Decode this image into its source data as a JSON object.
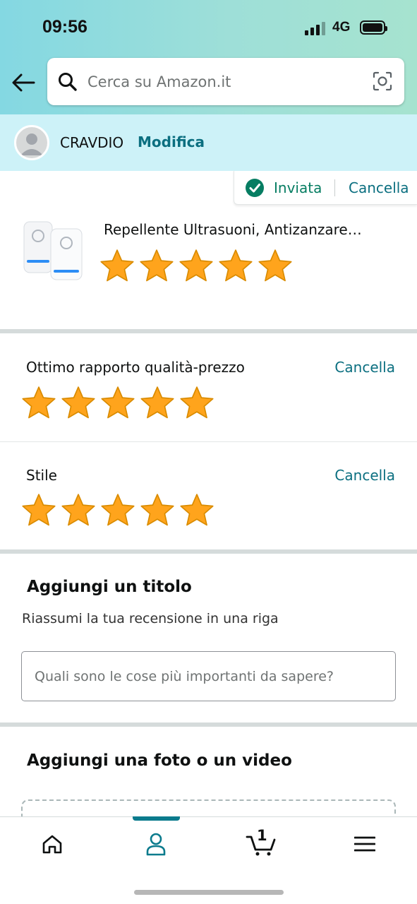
{
  "status_bar": {
    "time": "09:56",
    "network": "4G",
    "signal_bars": 4,
    "signal_bars_active": 3,
    "battery_level": 1.0
  },
  "header": {
    "back_icon": "arrow-left-icon",
    "search": {
      "placeholder": "Cerca su Amazon.it",
      "icon": "search-icon",
      "camera_icon": "camera-scan-icon"
    }
  },
  "account": {
    "name": "CRAVDIO",
    "edit_label": "Modifica",
    "avatar_icon": "user-avatar-icon"
  },
  "submitted": {
    "label": "Inviata",
    "cancel_label": "Cancella",
    "icon": "check-circle-icon"
  },
  "product": {
    "title": "Repellente Ultrasuoni, Antizanzare…",
    "rating": 5,
    "max_rating": 5
  },
  "attributes": [
    {
      "label": "Ottimo rapporto qualità-prezzo",
      "cancel_label": "Cancella",
      "rating": 5
    },
    {
      "label": "Stile",
      "cancel_label": "Cancella",
      "rating": 5
    }
  ],
  "title_section": {
    "heading": "Aggiungi un titolo",
    "hint": "Riassumi la tua recensione in una riga",
    "input_placeholder": "Quali sono le cose più importanti da sapere?",
    "input_value": ""
  },
  "media_section": {
    "heading": "Aggiungi una foto o un video"
  },
  "tabbar": {
    "tabs": [
      {
        "name": "home",
        "icon": "home-icon",
        "active": false
      },
      {
        "name": "account",
        "icon": "person-icon",
        "active": true
      },
      {
        "name": "cart",
        "icon": "cart-icon",
        "active": false,
        "count": "1"
      },
      {
        "name": "menu",
        "icon": "hamburger-menu-icon",
        "active": false
      }
    ]
  },
  "colors": {
    "star": "#ffa41c",
    "link": "#0b6f80",
    "success": "#067d62",
    "account_bar": "#cdf2f8",
    "tab_active": "#0b7b8d"
  }
}
